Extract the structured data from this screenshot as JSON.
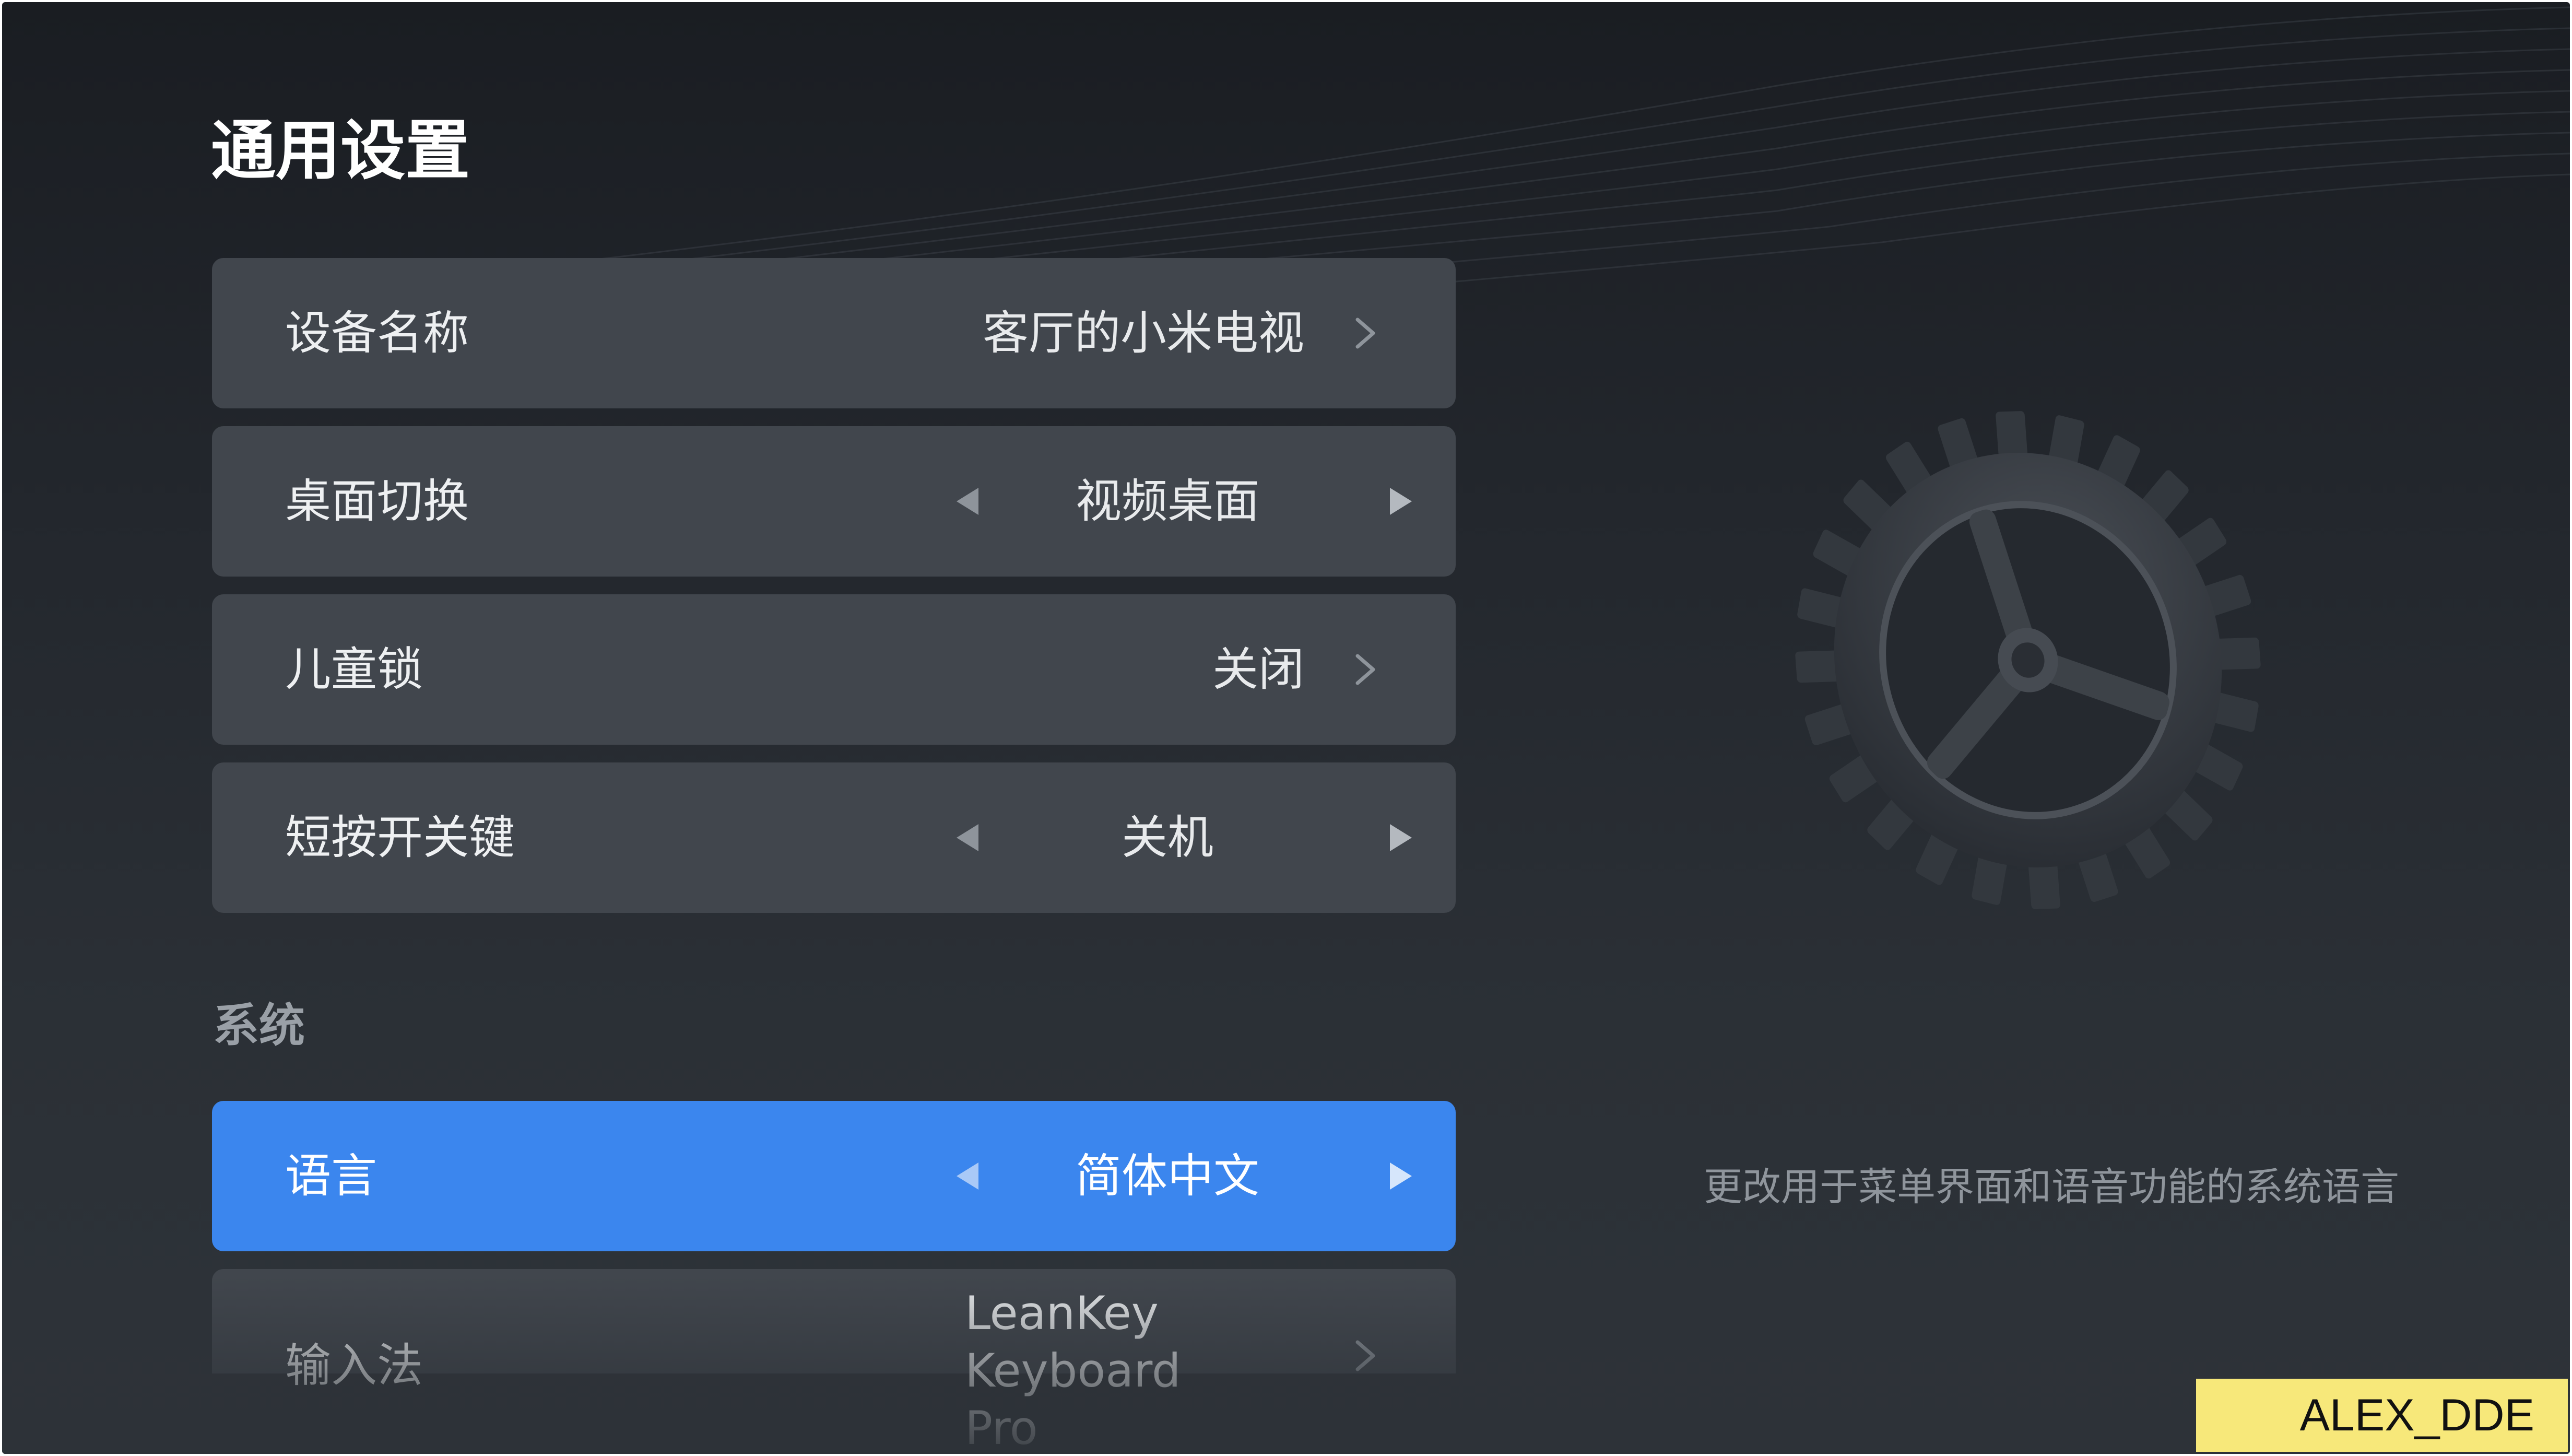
{
  "page": {
    "title": "通用设置"
  },
  "settings": [
    {
      "label": "设备名称",
      "value": "客厅的小米电视",
      "control": "chevron"
    },
    {
      "label": "桌面切换",
      "value": "视频桌面",
      "control": "arrows"
    },
    {
      "label": "儿童锁",
      "value": "关闭",
      "control": "chevron"
    },
    {
      "label": "短按开关键",
      "value": "关机",
      "control": "arrows"
    }
  ],
  "system": {
    "section_title": "系统",
    "items": [
      {
        "label": "语言",
        "value": "简体中文",
        "control": "arrows",
        "focused": true
      },
      {
        "label": "输入法",
        "value_line1": "LeanKey Keyboard",
        "value_line2": "Pro",
        "control": "chevron"
      }
    ]
  },
  "side_panel": {
    "icon": "gear-icon",
    "description": "更改用于菜单界面和语音功能的系统语言"
  },
  "watermark": "ALEX_DDE",
  "colors": {
    "background": "#23272d",
    "row": "#41464d",
    "focus": "#3b86ee",
    "text": "#ffffff",
    "muted": "#9aa0a7",
    "watermark_bg": "#f7e87a"
  }
}
